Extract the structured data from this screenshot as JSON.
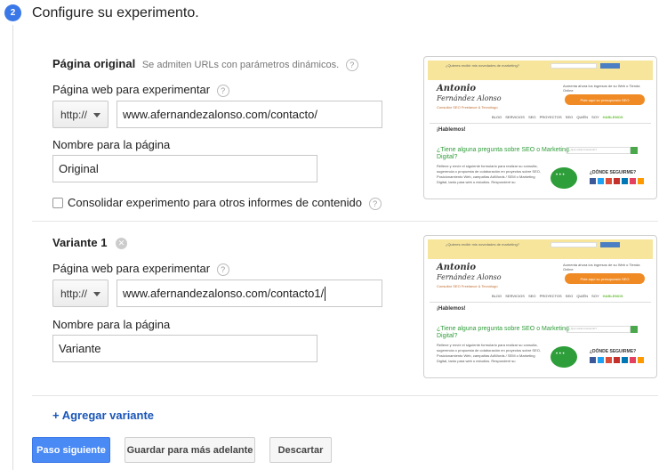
{
  "step": {
    "number": "2",
    "title": "Configure su experimento."
  },
  "original": {
    "section_title": "Página original",
    "hint": "Se admiten URLs con parámetros dinámicos.",
    "url_label": "Página web para experimentar",
    "protocol": "http://",
    "url_value": "www.afernandezalonso.com/contacto/",
    "name_label": "Nombre para la página",
    "name_value": "Original",
    "consolidate_label": "Consolidar experimento para otros informes de contenido"
  },
  "variant": {
    "section_title": "Variante 1",
    "url_label": "Página web para experimentar",
    "protocol": "http://",
    "url_value": "www.afernandezalonso.com/contacto1/",
    "name_label": "Nombre para la página",
    "name_value": "Variante"
  },
  "preview": {
    "topbar_text": "¿Quieres recibir mis novedades de marketing?",
    "logo_line1": "Antonio",
    "logo_line2": "Fernández Alonso",
    "logo_line3": "Consultor SEO Freelance & Tecnólogo",
    "cta_text": "Aumenta ahora los ingresos de su Web o Tienda Online",
    "cta_button": "Pide aquí su presupuesto SEO",
    "nav_items": [
      "BLOG",
      "SERVICIOS SEO",
      "PROYECTOS SEO",
      "QUIÉN SOY"
    ],
    "nav_active": "HABLEMOS",
    "hablemos": "¡Hablemos!",
    "question": "¿Tiene alguna pregunta sobre SEO o Marketing Digital?",
    "paragraph": "Rellene y envíe el siguiente formulario para realizar su consulta, sugerencia o propuesta de colaboración en proyectos sobre SEO, Posicionamiento Web, campañas AdWords / SEM o Marketing Digital, tanto para web o estudios. Responderé su",
    "search_placeholder": "¿Qué estás buscando?",
    "donde": "¿DÓNDE SEGUIRME?",
    "social_colors": [
      "#3b5998",
      "#1da1f2",
      "#dd4b39",
      "#c4302b",
      "#0077b5",
      "#e4405f",
      "#ff9900"
    ]
  },
  "actions": {
    "add_variant": "+ Agregar variante",
    "next": "Paso siguiente",
    "save_later": "Guardar para más adelante",
    "discard": "Descartar"
  }
}
